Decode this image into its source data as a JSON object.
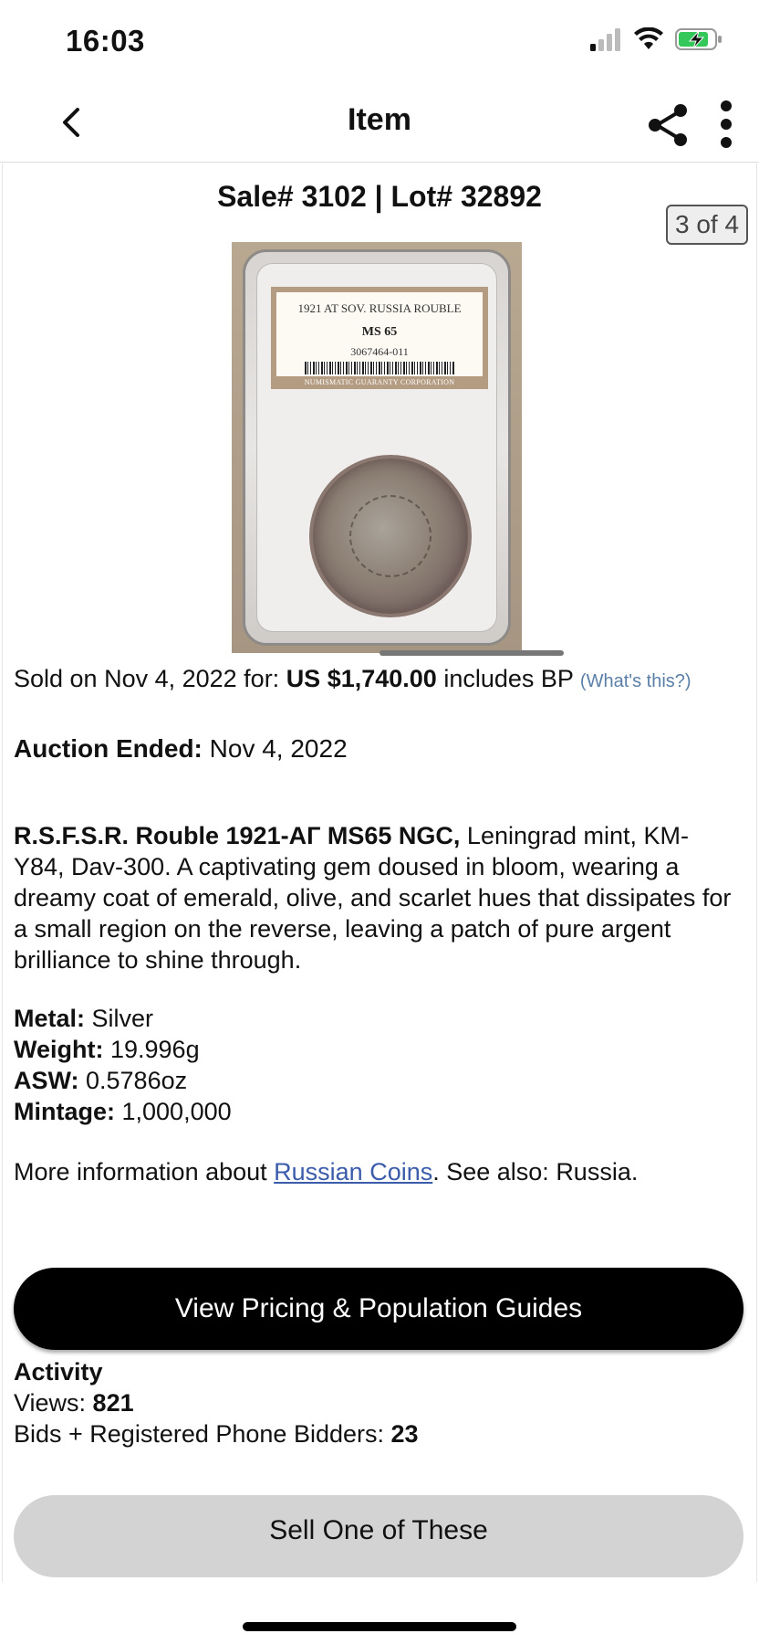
{
  "status": {
    "time": "16:03",
    "battery_color": "#34c759"
  },
  "nav": {
    "title": "Item"
  },
  "item": {
    "sale_lot": "Sale# 3102 | Lot# 32892",
    "photo_counter": "3 of 4",
    "slab_label": {
      "line1": "1921 AT SOV. RUSSIA ROUBLE",
      "grade": "MS 65",
      "cert": "3067464-011",
      "footer": "NUMISMATIC GUARANTY CORPORATION"
    },
    "sold_prefix": "Sold on Nov 4, 2022 for: ",
    "sold_price": "US $1,740.00",
    "sold_suffix": " includes BP ",
    "whats_this": "(What's this?)",
    "auction_ended_label": "Auction Ended:",
    "auction_ended_value": " Nov 4, 2022",
    "description_bold": "R.S.F.S.R. Rouble 1921-АГ MS65 NGC,",
    "description_text": " Leningrad mint, KM-Y84, Dav-300. A captivating gem doused in bloom, wearing a dreamy coat of emerald, olive, and scarlet hues that dissipates for a small region on the reverse, leaving a patch of pure argent brilliance to shine through.",
    "specs": {
      "metal_label": "Metal:",
      "metal_value": " Silver",
      "weight_label": "Weight:",
      "weight_value": " 19.996g",
      "asw_label": "ASW:",
      "asw_value": " 0.5786oz",
      "mintage_label": "Mintage:",
      "mintage_value": " 1,000,000"
    },
    "more_info_prefix": "More information about ",
    "more_info_link": "Russian Coins",
    "more_info_suffix": ". See also: Russia."
  },
  "buttons": {
    "pricing": "View Pricing & Population Guides",
    "sell": "Sell One of These"
  },
  "activity": {
    "title": "Activity",
    "views_label": "Views: ",
    "views_value": "821",
    "bids_label": "Bids + Registered Phone Bidders: ",
    "bids_value": "23"
  }
}
